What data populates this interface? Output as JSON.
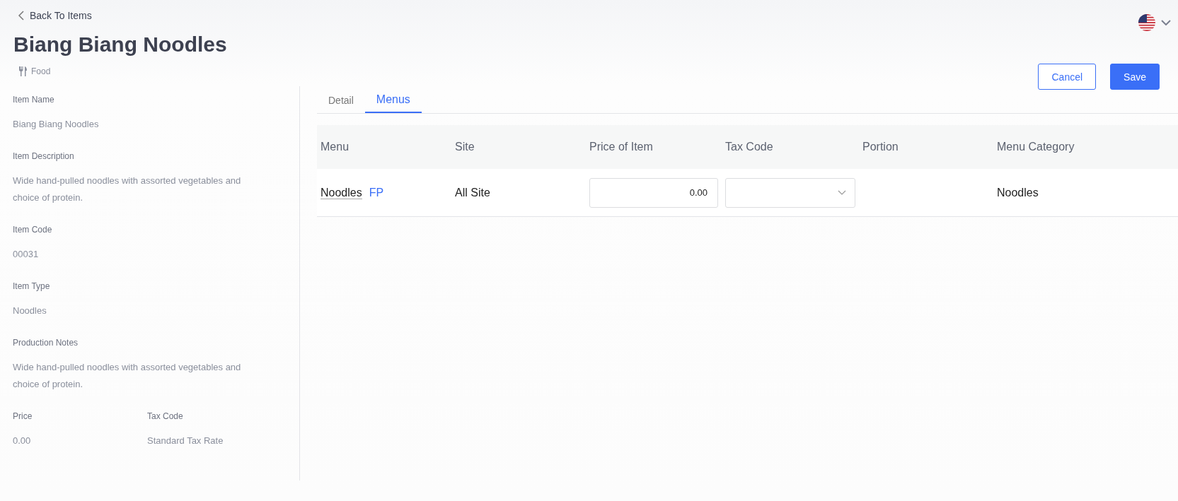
{
  "back_link": "Back To Items",
  "title": "Biang Biang Noodles",
  "category": "Food",
  "actions": [
    {
      "label": "Cancel",
      "kind": "secondary"
    },
    {
      "label": "Save",
      "kind": "primary"
    }
  ],
  "details": [
    {
      "label": "Item Name",
      "value": "Biang Biang Noodles"
    },
    {
      "label": "Item Description",
      "value": "Wide hand-pulled noodles with assorted vegetables and choice of protein."
    },
    {
      "label": "Item Code",
      "value": "00031"
    },
    {
      "label": "Item Type",
      "value": "Noodles"
    },
    {
      "label": "Production Notes",
      "value": "Wide hand-pulled noodles with assorted vegetables and choice of protein."
    }
  ],
  "detail_pairs": [
    {
      "label": "Price",
      "value": "0.00"
    },
    {
      "label": "Tax Code",
      "value": "Standard Tax Rate"
    }
  ],
  "tabs": [
    {
      "label": "Detail",
      "selected": false
    },
    {
      "label": "Menus",
      "selected": true
    }
  ],
  "table": {
    "columns": [
      "Menu",
      "Site",
      "Price of Item",
      "Tax Code",
      "Portion",
      "Menu Category"
    ],
    "rows": [
      {
        "menu": "Noodles",
        "badge": "FP",
        "site": "All Site",
        "price": "0.00",
        "menu_category": "Noodles"
      }
    ]
  }
}
